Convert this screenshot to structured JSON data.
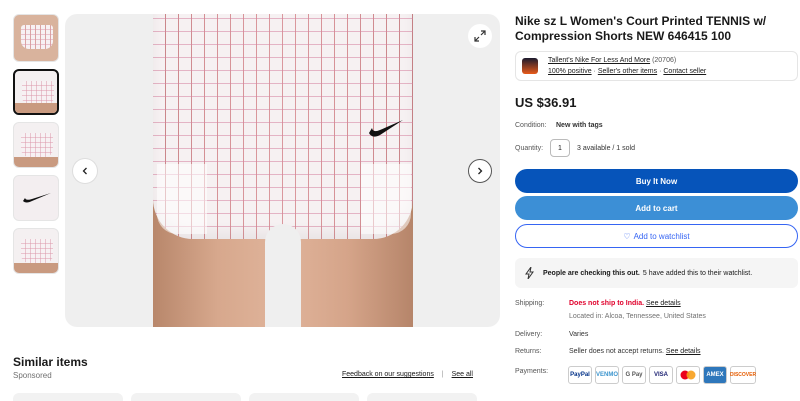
{
  "product": {
    "title": "Nike sz L Women's Court Printed TENNIS w/ Compression Shorts NEW 646415 100",
    "price": "US $36.91",
    "condition_label": "Condition:",
    "condition_value": "New with tags",
    "quantity_label": "Quantity:",
    "quantity_value": "1",
    "availability": "3 available / 1 sold"
  },
  "seller": {
    "name": "Tallent's Nike For Less And More",
    "feedback_count": "(20706)",
    "positive": "100% positive",
    "other_items": "Seller's other items",
    "contact": "Contact seller"
  },
  "buttons": {
    "buy_now": "Buy It Now",
    "add_to_cart": "Add to cart",
    "add_to_watchlist": "Add to watchlist"
  },
  "signal": {
    "bold": "People are checking this out.",
    "rest": "5 have added this to their watchlist."
  },
  "shipping": {
    "label": "Shipping:",
    "status": "Does not ship to India.",
    "details_link": "See details",
    "location": "Located in: Alcoa, Tennessee, United States"
  },
  "delivery": {
    "label": "Delivery:",
    "value": "Varies"
  },
  "returns": {
    "label": "Returns:",
    "value": "Seller does not accept returns.",
    "details_link": "See details"
  },
  "payments": {
    "label": "Payments:",
    "methods": [
      "PayPal",
      "VENMO",
      "G Pay",
      "VISA",
      "MC",
      "AMEX",
      "DISCOVER"
    ]
  },
  "similar": {
    "heading": "Similar items",
    "sponsored": "Sponsored",
    "feedback_link": "Feedback on our suggestions",
    "see_all": "See all"
  },
  "icons": {
    "prev": "chevron-left-icon",
    "next": "chevron-right-icon",
    "expand": "expand-icon",
    "heart": "heart-icon",
    "lightning": "lightning-icon"
  },
  "colors": {
    "buy_now": "#0654ba",
    "add_to_cart": "#3c8fd6",
    "link_blue": "#3665f3",
    "alert_red": "#e0002b"
  }
}
